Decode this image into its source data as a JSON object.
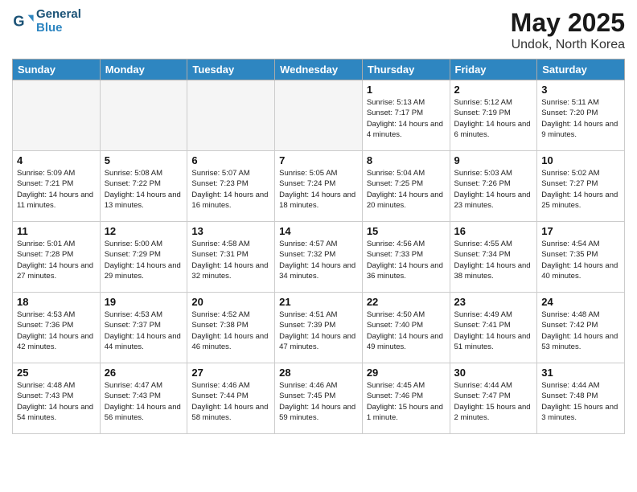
{
  "header": {
    "logo_line1": "General",
    "logo_line2": "Blue",
    "month": "May 2025",
    "location": "Undok, North Korea"
  },
  "days_of_week": [
    "Sunday",
    "Monday",
    "Tuesday",
    "Wednesday",
    "Thursday",
    "Friday",
    "Saturday"
  ],
  "weeks": [
    [
      {
        "day": "",
        "info": ""
      },
      {
        "day": "",
        "info": ""
      },
      {
        "day": "",
        "info": ""
      },
      {
        "day": "",
        "info": ""
      },
      {
        "day": "1",
        "info": "Sunrise: 5:13 AM\nSunset: 7:17 PM\nDaylight: 14 hours\nand 4 minutes."
      },
      {
        "day": "2",
        "info": "Sunrise: 5:12 AM\nSunset: 7:19 PM\nDaylight: 14 hours\nand 6 minutes."
      },
      {
        "day": "3",
        "info": "Sunrise: 5:11 AM\nSunset: 7:20 PM\nDaylight: 14 hours\nand 9 minutes."
      }
    ],
    [
      {
        "day": "4",
        "info": "Sunrise: 5:09 AM\nSunset: 7:21 PM\nDaylight: 14 hours\nand 11 minutes."
      },
      {
        "day": "5",
        "info": "Sunrise: 5:08 AM\nSunset: 7:22 PM\nDaylight: 14 hours\nand 13 minutes."
      },
      {
        "day": "6",
        "info": "Sunrise: 5:07 AM\nSunset: 7:23 PM\nDaylight: 14 hours\nand 16 minutes."
      },
      {
        "day": "7",
        "info": "Sunrise: 5:05 AM\nSunset: 7:24 PM\nDaylight: 14 hours\nand 18 minutes."
      },
      {
        "day": "8",
        "info": "Sunrise: 5:04 AM\nSunset: 7:25 PM\nDaylight: 14 hours\nand 20 minutes."
      },
      {
        "day": "9",
        "info": "Sunrise: 5:03 AM\nSunset: 7:26 PM\nDaylight: 14 hours\nand 23 minutes."
      },
      {
        "day": "10",
        "info": "Sunrise: 5:02 AM\nSunset: 7:27 PM\nDaylight: 14 hours\nand 25 minutes."
      }
    ],
    [
      {
        "day": "11",
        "info": "Sunrise: 5:01 AM\nSunset: 7:28 PM\nDaylight: 14 hours\nand 27 minutes."
      },
      {
        "day": "12",
        "info": "Sunrise: 5:00 AM\nSunset: 7:29 PM\nDaylight: 14 hours\nand 29 minutes."
      },
      {
        "day": "13",
        "info": "Sunrise: 4:58 AM\nSunset: 7:31 PM\nDaylight: 14 hours\nand 32 minutes."
      },
      {
        "day": "14",
        "info": "Sunrise: 4:57 AM\nSunset: 7:32 PM\nDaylight: 14 hours\nand 34 minutes."
      },
      {
        "day": "15",
        "info": "Sunrise: 4:56 AM\nSunset: 7:33 PM\nDaylight: 14 hours\nand 36 minutes."
      },
      {
        "day": "16",
        "info": "Sunrise: 4:55 AM\nSunset: 7:34 PM\nDaylight: 14 hours\nand 38 minutes."
      },
      {
        "day": "17",
        "info": "Sunrise: 4:54 AM\nSunset: 7:35 PM\nDaylight: 14 hours\nand 40 minutes."
      }
    ],
    [
      {
        "day": "18",
        "info": "Sunrise: 4:53 AM\nSunset: 7:36 PM\nDaylight: 14 hours\nand 42 minutes."
      },
      {
        "day": "19",
        "info": "Sunrise: 4:53 AM\nSunset: 7:37 PM\nDaylight: 14 hours\nand 44 minutes."
      },
      {
        "day": "20",
        "info": "Sunrise: 4:52 AM\nSunset: 7:38 PM\nDaylight: 14 hours\nand 46 minutes."
      },
      {
        "day": "21",
        "info": "Sunrise: 4:51 AM\nSunset: 7:39 PM\nDaylight: 14 hours\nand 47 minutes."
      },
      {
        "day": "22",
        "info": "Sunrise: 4:50 AM\nSunset: 7:40 PM\nDaylight: 14 hours\nand 49 minutes."
      },
      {
        "day": "23",
        "info": "Sunrise: 4:49 AM\nSunset: 7:41 PM\nDaylight: 14 hours\nand 51 minutes."
      },
      {
        "day": "24",
        "info": "Sunrise: 4:48 AM\nSunset: 7:42 PM\nDaylight: 14 hours\nand 53 minutes."
      }
    ],
    [
      {
        "day": "25",
        "info": "Sunrise: 4:48 AM\nSunset: 7:43 PM\nDaylight: 14 hours\nand 54 minutes."
      },
      {
        "day": "26",
        "info": "Sunrise: 4:47 AM\nSunset: 7:43 PM\nDaylight: 14 hours\nand 56 minutes."
      },
      {
        "day": "27",
        "info": "Sunrise: 4:46 AM\nSunset: 7:44 PM\nDaylight: 14 hours\nand 58 minutes."
      },
      {
        "day": "28",
        "info": "Sunrise: 4:46 AM\nSunset: 7:45 PM\nDaylight: 14 hours\nand 59 minutes."
      },
      {
        "day": "29",
        "info": "Sunrise: 4:45 AM\nSunset: 7:46 PM\nDaylight: 15 hours\nand 1 minute."
      },
      {
        "day": "30",
        "info": "Sunrise: 4:44 AM\nSunset: 7:47 PM\nDaylight: 15 hours\nand 2 minutes."
      },
      {
        "day": "31",
        "info": "Sunrise: 4:44 AM\nSunset: 7:48 PM\nDaylight: 15 hours\nand 3 minutes."
      }
    ]
  ]
}
